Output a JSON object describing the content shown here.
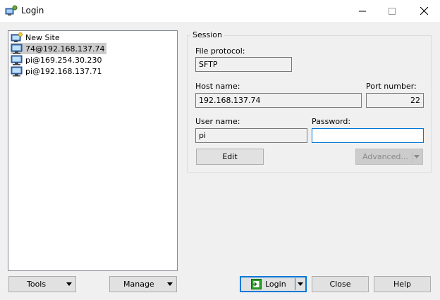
{
  "window": {
    "title": "Login"
  },
  "sites": [
    {
      "label": "New Site",
      "icon": "new-site-icon",
      "selected": false
    },
    {
      "label": "74@192.168.137.74",
      "icon": "computer-icon",
      "selected": true
    },
    {
      "label": "pi@169.254.30.230",
      "icon": "computer-icon",
      "selected": false
    },
    {
      "label": "pi@192.168.137.71",
      "icon": "computer-icon",
      "selected": false
    }
  ],
  "session": {
    "legend": "Session",
    "file_protocol_label": "File protocol:",
    "file_protocol": "SFTP",
    "host_label": "Host name:",
    "host": "192.168.137.74",
    "port_label": "Port number:",
    "port": "22",
    "user_label": "User name:",
    "user": "pi",
    "password_label": "Password:",
    "password": "",
    "edit_label": "Edit",
    "advanced_label": "Advanced..."
  },
  "buttons": {
    "tools": "Tools",
    "manage": "Manage",
    "login": "Login",
    "close": "Close",
    "help": "Help"
  },
  "colors": {
    "accent": "#0078d7",
    "selection": "#cccccc",
    "login_icon": "#2aa12a"
  }
}
